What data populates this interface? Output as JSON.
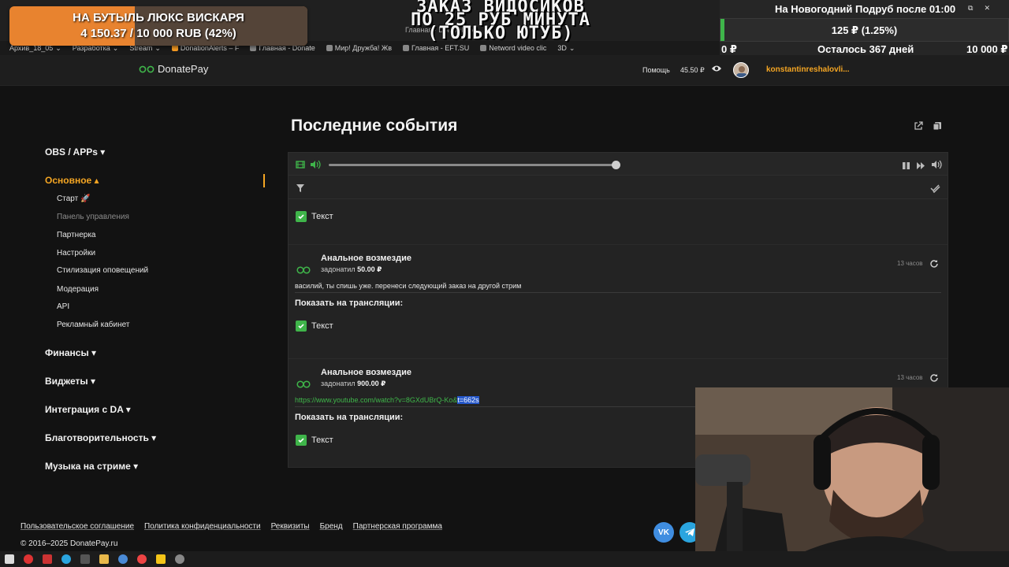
{
  "overlay": {
    "goal_title": "НА БУТЫЛЬ ЛЮКС ВИСКАРЯ",
    "goal_progress_text": "4 150.37 / 10 000 RUB (42%)",
    "goal_fraction": 0.42,
    "headline_lines": [
      "ЗАКАЗ ВИДОСИКОВ",
      "ПО 25 РУБ МИНУТА",
      "(ТОЛЬКО ЮТУБ)"
    ],
    "ghost_tab": "Главная · DonatePay",
    "right_goal_title": "На Новогодний Подруб  после 01:00",
    "right_goal_amount": "125 ₽ (1.25%)",
    "right_goal_fraction": 0.0125,
    "right_goal_min": "0 ₽",
    "right_goal_remaining": "Осталось 367 дней",
    "right_goal_max": "10 000 ₽"
  },
  "bookmarks": [
    {
      "label": "Архив_18_05",
      "has_menu": true
    },
    {
      "label": "Разработка",
      "has_menu": true
    },
    {
      "label": "Stream",
      "has_menu": true
    },
    {
      "label": "DonationAlerts – F",
      "has_menu": false
    },
    {
      "label": "Главная - Donate",
      "has_menu": false
    },
    {
      "label": "Мир! Дружба! Жв",
      "has_menu": false
    },
    {
      "label": "Главная - EFT.SU",
      "has_menu": false
    },
    {
      "label": "Netword video clic",
      "has_menu": false
    },
    {
      "label": "3D",
      "has_menu": true
    }
  ],
  "header": {
    "logo": "DonatePay",
    "help": "Помощь",
    "balance": "45.50 ₽",
    "username": "konstantinreshalovli..."
  },
  "sidebar": {
    "sections": [
      {
        "label": "OBS / APPs ▾"
      },
      {
        "label": "Основное ▴"
      },
      {
        "label": "Финансы ▾"
      },
      {
        "label": "Виджеты ▾"
      },
      {
        "label": "Интеграция с DA ▾"
      },
      {
        "label": "Благотворительность ▾"
      },
      {
        "label": "Музыка на стриме ▾"
      }
    ],
    "items": [
      {
        "label": "Старт 🚀"
      },
      {
        "label": "Панель управления"
      },
      {
        "label": "Партнерка"
      },
      {
        "label": "Настройки"
      },
      {
        "label": "Стилизация оповещений"
      },
      {
        "label": "Модерация"
      },
      {
        "label": "API"
      },
      {
        "label": "Рекламный кабинет"
      }
    ]
  },
  "main": {
    "title": "Последние события",
    "first_check_label": "Текст",
    "events": [
      {
        "name": "Анальное возмездие",
        "donated_prefix": "задонатил",
        "amount": "50.00 ₽",
        "time": "13 часов",
        "message": "василий, ты спишь уже. перенеси следующий заказ на другой стрим",
        "show_label": "Показать на трансляции:",
        "check_label": "Текст"
      },
      {
        "name": "Анальное возмездие",
        "donated_prefix": "задонатил",
        "amount": "900.00 ₽",
        "time": "13 часов",
        "message_link": "https://www.youtube.com/watch?v=8GXdUBrQ-Ko&",
        "message_link_selected": "t=662s",
        "show_label": "Показать на трансляции:",
        "check_label": "Текст"
      }
    ]
  },
  "footer": {
    "links": [
      "Пользовательское соглашение",
      "Политика конфиденциальности",
      "Реквизиты",
      "Бренд",
      "Партнерская программа"
    ],
    "copyright": "© 2016–2025 DonatePay.ru",
    "vk": "VK"
  },
  "colors": {
    "accent": "#f5a623",
    "success": "#3fb54a",
    "link": "#3fb54a",
    "bg": "#121212",
    "panel": "#232323"
  }
}
